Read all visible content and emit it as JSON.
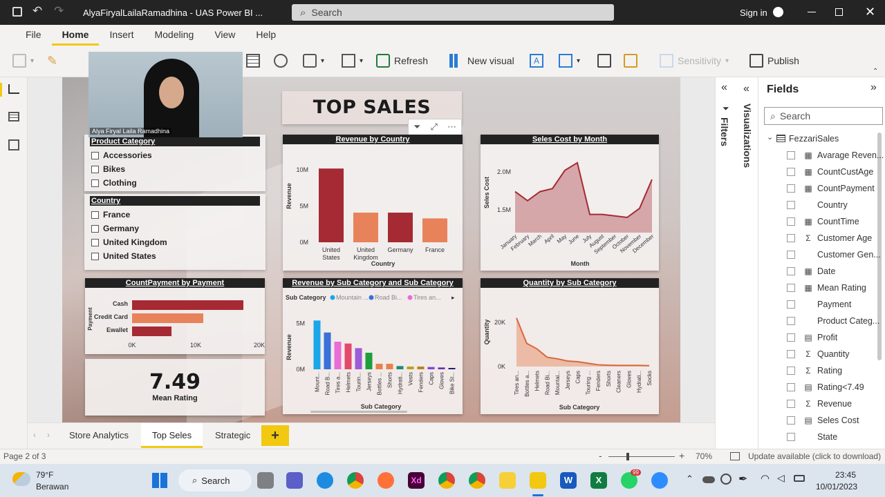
{
  "titlebar": {
    "title": "AlyaFiryalLailaRamadhina - UAS Power BI ...",
    "search": "Search",
    "signin": "Sign in"
  },
  "menu": {
    "items": [
      "File",
      "Home",
      "Insert",
      "Modeling",
      "View",
      "Help"
    ],
    "active": "Home"
  },
  "ribbon": {
    "refresh": "Refresh",
    "new_visual": "New visual",
    "sensitivity": "Sensitivity",
    "publish": "Publish"
  },
  "webcam": {
    "name": "Alya Firyal Laila Ramadhina"
  },
  "report": {
    "title": "TOP SALES",
    "slicers": [
      {
        "header": "Product Category",
        "items": [
          "Accessories",
          "Bikes",
          "Clothing"
        ]
      },
      {
        "header": "Country",
        "items": [
          "France",
          "Germany",
          "United Kingdom",
          "United States"
        ]
      }
    ],
    "kpi": {
      "value": "7.49",
      "label": "Mean Rating"
    }
  },
  "chart_data": [
    {
      "type": "bar",
      "title": "Revenue by Country",
      "xlabel": "Country",
      "ylabel": "Revenue",
      "categories": [
        "United States",
        "United Kingdom",
        "Germany",
        "France"
      ],
      "values": [
        10.2,
        4.1,
        4.1,
        3.3
      ],
      "ylim": [
        0,
        10
      ],
      "yticks": [
        "0M",
        "5M",
        "10M"
      ],
      "colors": [
        "#a52a34",
        "#e8825a",
        "#a52a34",
        "#e8825a"
      ]
    },
    {
      "type": "area",
      "title": "Seles Cost by Month",
      "xlabel": "Month",
      "ylabel": "Seles Cost",
      "categories": [
        "January",
        "February",
        "March",
        "April",
        "May",
        "June",
        "July",
        "August",
        "September",
        "October",
        "November",
        "December"
      ],
      "values": [
        1.74,
        1.62,
        1.74,
        1.78,
        2.02,
        2.12,
        1.44,
        1.44,
        1.42,
        1.4,
        1.52,
        1.9
      ],
      "ylim": [
        1.2,
        2.2
      ],
      "yticks": [
        "1.5M",
        "2.0M"
      ],
      "color": "#a52a34"
    },
    {
      "type": "bar",
      "orientation": "horizontal",
      "title": "CountPayment by Payment",
      "ylabel": "Payment",
      "categories": [
        "Cash",
        "Credit Card",
        "Ewallet"
      ],
      "values": [
        17.5,
        11.2,
        6.2
      ],
      "xlim": [
        0,
        20
      ],
      "xticks": [
        "0K",
        "10K",
        "20K"
      ],
      "colors": [
        "#a52a34",
        "#e8825a",
        "#a52a34"
      ]
    },
    {
      "type": "bar",
      "title": "Revenue by Sub Category and Sub Category",
      "xlabel": "Sub Category",
      "ylabel": "Revenue",
      "legend_title": "Sub Category",
      "legend": [
        "Mountain ...",
        "Road Bi...",
        "Tires an..."
      ],
      "categories": [
        "Mount...",
        "Road B...",
        "Tires a...",
        "Helmets",
        "Tourin...",
        "Jerseys",
        "Bottles ...",
        "Shorts",
        "Hydrati...",
        "Vests",
        "Fenders",
        "Caps",
        "Gloves",
        "Bike St..."
      ],
      "values": [
        5.3,
        4.0,
        3.0,
        2.8,
        2.3,
        1.8,
        0.6,
        0.6,
        0.35,
        0.3,
        0.3,
        0.25,
        0.2,
        0.15
      ],
      "ylim": [
        0,
        6
      ],
      "yticks": [
        "0M",
        "5M"
      ],
      "colors": [
        "#1aa6e8",
        "#3b6fd9",
        "#e96dd6",
        "#e24a6c",
        "#9b5cd6",
        "#1e9e3c",
        "#e8824a",
        "#e8824a",
        "#1e8a7a",
        "#b8a320",
        "#c0821a",
        "#8a3fd6",
        "#6a2fb4",
        "#1a1f6e"
      ]
    },
    {
      "type": "area",
      "title": "Quantity by Sub Category",
      "xlabel": "Sub Category",
      "ylabel": "Quantity",
      "categories": [
        "Tires an...",
        "Bottles a...",
        "Helmets",
        "Road Bi...",
        "Mountai...",
        "Jerseys",
        "Caps",
        "Touring ...",
        "Fenders",
        "Shorts",
        "Cleaners",
        "Gloves",
        "Hydrati...",
        "Socks"
      ],
      "values": [
        22,
        10.5,
        8,
        4.2,
        3.5,
        2.5,
        2.2,
        1.5,
        0.8,
        0.6,
        0.5,
        0.5,
        0.5,
        0.4
      ],
      "ylim": [
        0,
        25
      ],
      "yticks": [
        "0K",
        "20K"
      ],
      "color": "#e8825a"
    }
  ],
  "panes": {
    "filters": "Filters",
    "visualizations": "Visualizations",
    "fields_title": "Fields",
    "search_placeholder": "Search",
    "table": "FezzariSales"
  },
  "fields": [
    {
      "name": "Avarage Reven...",
      "icon": "calc"
    },
    {
      "name": "CountCustAge",
      "icon": "calc"
    },
    {
      "name": "CountPayment",
      "icon": "calc"
    },
    {
      "name": "Country",
      "icon": ""
    },
    {
      "name": "CountTime",
      "icon": "calc"
    },
    {
      "name": "Customer Age",
      "icon": "sigma"
    },
    {
      "name": "Customer Gen...",
      "icon": ""
    },
    {
      "name": "Date",
      "icon": "table"
    },
    {
      "name": "Mean Rating",
      "icon": "calc"
    },
    {
      "name": "Payment",
      "icon": ""
    },
    {
      "name": "Product Categ...",
      "icon": ""
    },
    {
      "name": "Profit",
      "icon": "measure"
    },
    {
      "name": "Quantity",
      "icon": "sigma"
    },
    {
      "name": "Rating",
      "icon": "sigma"
    },
    {
      "name": "Rating<7.49",
      "icon": "measure"
    },
    {
      "name": "Revenue",
      "icon": "sigma"
    },
    {
      "name": "Seles Cost",
      "icon": "measure"
    },
    {
      "name": "State",
      "icon": ""
    }
  ],
  "tabs": [
    "Store Analytics",
    "Top Seles",
    "Strategic"
  ],
  "active_tab": "Top Seles",
  "status": {
    "page": "Page 2 of 3",
    "zoom": "70%",
    "update": "Update available (click to download)"
  },
  "taskbar": {
    "temp": "79°F",
    "weather": "Berawan",
    "search": "Search",
    "time": "23:45",
    "date": "10/01/2023",
    "badge": "99"
  }
}
